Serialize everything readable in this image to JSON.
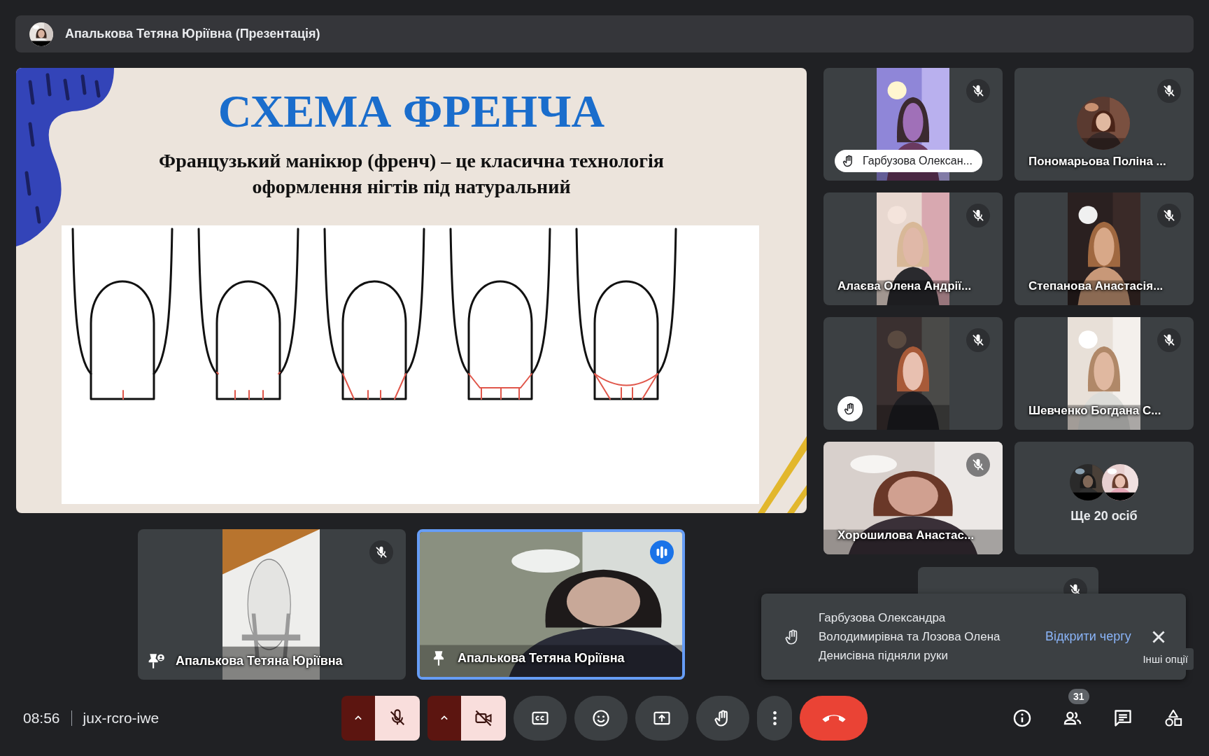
{
  "presentation_bar": {
    "title": "Апалькова Тетяна Юріївна (Презентація)"
  },
  "slide": {
    "title": "СХЕМА ФРЕНЧА",
    "text": "Французький манікюр (френч) – це класична технологія оформлення нігтів під натуральний"
  },
  "stage_tiles": [
    {
      "name": "Апалькова Тетяна Юріївна",
      "kind": "paper",
      "muted": true,
      "speaking": false
    },
    {
      "name": "Апалькова Тетяна Юріївна",
      "kind": "camera",
      "muted": false,
      "speaking": true
    }
  ],
  "participants": [
    {
      "kind": "portrait",
      "name": "Гарбузова Олексан...",
      "muted": true,
      "hand_raised": true
    },
    {
      "kind": "avatar",
      "name": "Пономарьова Поліна ...",
      "muted": true,
      "hand_raised": false
    },
    {
      "kind": "portrait",
      "name": "Алаєва Олена Андрії...",
      "muted": true,
      "hand_raised": false
    },
    {
      "kind": "portrait",
      "name": "Степанова Анастасія...",
      "muted": true,
      "hand_raised": false
    },
    {
      "kind": "portrait",
      "muted": true,
      "hand_raised": true
    },
    {
      "kind": "portrait",
      "name": "Шевченко Богдана С...",
      "muted": true,
      "hand_raised": false
    },
    {
      "kind": "full",
      "name": "Хорошилова Анастас...",
      "muted": true,
      "hand_raised": false
    },
    {
      "kind": "more",
      "label": "Ще 20 осіб"
    }
  ],
  "partial_tile": {
    "muted": true
  },
  "notification": {
    "text": "Гарбузова Олександра Володимирівна та Лозова Олена Денисівна підняли руки",
    "action": "Відкрити чергу"
  },
  "tooltip": {
    "text": "Інші опції"
  },
  "bottom_bar": {
    "time": "08:56",
    "meeting_code": "jux-rcro-iwe",
    "controls": [
      {
        "kind": "mic",
        "on": false
      },
      {
        "kind": "camera",
        "on": false
      },
      {
        "kind": "captions"
      },
      {
        "kind": "reactions"
      },
      {
        "kind": "present"
      },
      {
        "kind": "raise_hand"
      },
      {
        "kind": "more"
      },
      {
        "kind": "end_call"
      }
    ],
    "side_controls": [
      {
        "kind": "info"
      },
      {
        "kind": "people",
        "badge": "31"
      },
      {
        "kind": "chat"
      },
      {
        "kind": "activities"
      }
    ]
  }
}
